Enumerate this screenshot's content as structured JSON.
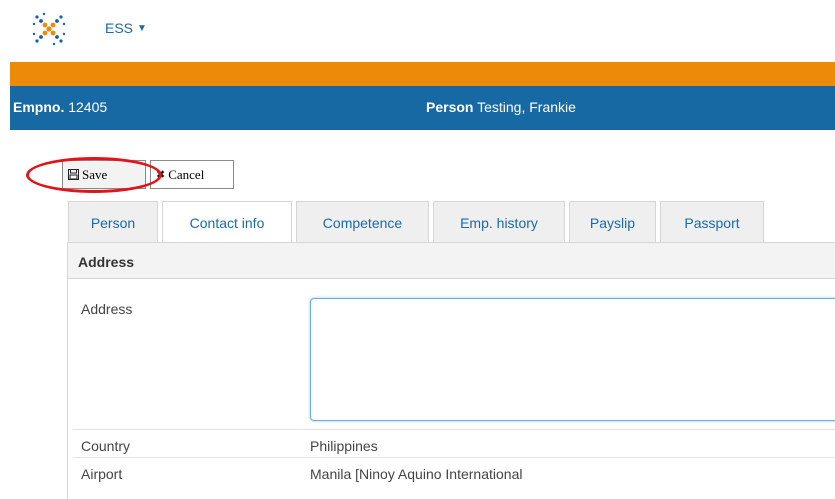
{
  "header": {
    "module": "ESS"
  },
  "employee_bar": {
    "empno_label": "Empno.",
    "empno_value": "12405",
    "person_label": "Person",
    "person_value": "Testing, Frankie"
  },
  "toolbar": {
    "save_label": "Save",
    "cancel_label": "Cancel"
  },
  "tabs": [
    {
      "label": "Person"
    },
    {
      "label": "Contact info",
      "active": true
    },
    {
      "label": "Competence"
    },
    {
      "label": "Emp. history"
    },
    {
      "label": "Payslip"
    },
    {
      "label": "Passport"
    }
  ],
  "section": {
    "title": "Address"
  },
  "fields": {
    "address": {
      "label": "Address",
      "value": ""
    },
    "country": {
      "label": "Country",
      "value": "Philippines"
    },
    "airport": {
      "label": "Airport",
      "value": "Manila [Ninoy Aquino International"
    }
  },
  "colors": {
    "orange_bar": "#ee8a0a",
    "blue_bar": "#1769a4",
    "highlight": "#e0141b",
    "link": "#1a6aa8"
  }
}
